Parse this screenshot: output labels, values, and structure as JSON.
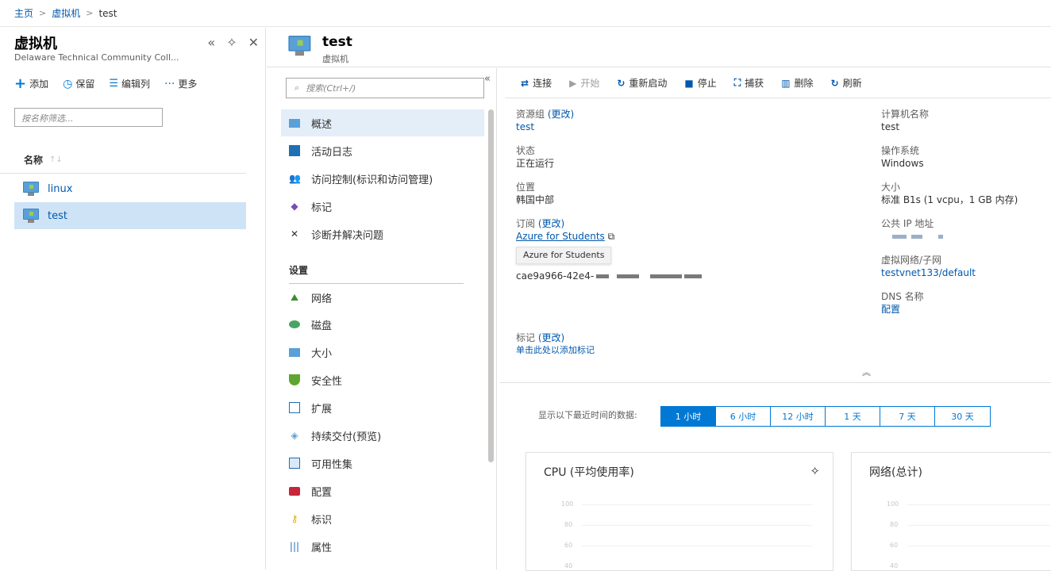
{
  "breadcrumb": [
    "主页",
    "虚拟机",
    "test"
  ],
  "left_blade": {
    "title": "虚拟机",
    "subtitle": "Delaware Technical Community Coll...",
    "toolbar": [
      {
        "icon": "plus-icon",
        "label": "添加"
      },
      {
        "icon": "clock-icon",
        "label": "保留"
      },
      {
        "icon": "columns-icon",
        "label": "编辑列"
      },
      {
        "icon": "more-icon",
        "label": "更多"
      }
    ],
    "filter_placeholder": "按名称筛选...",
    "column_header": "名称",
    "vms": [
      {
        "name": "linux",
        "selected": false
      },
      {
        "name": "test",
        "selected": true
      }
    ]
  },
  "vm_header": {
    "title": "test",
    "subtitle": "虚拟机"
  },
  "menu": {
    "search_placeholder": "搜索(Ctrl+/)",
    "items_top": [
      {
        "label": "概述",
        "icon": "monitor-icon",
        "active": true
      },
      {
        "label": "活动日志",
        "icon": "log-icon"
      },
      {
        "label": "访问控制(标识和访问管理)",
        "icon": "people-icon"
      },
      {
        "label": "标记",
        "icon": "tag-icon"
      },
      {
        "label": "诊断并解决问题",
        "icon": "wrench-icon"
      }
    ],
    "section": "设置",
    "items_settings": [
      {
        "label": "网络",
        "icon": "network-icon"
      },
      {
        "label": "磁盘",
        "icon": "disk-icon"
      },
      {
        "label": "大小",
        "icon": "monitor-icon"
      },
      {
        "label": "安全性",
        "icon": "shield-icon"
      },
      {
        "label": "扩展",
        "icon": "extensions-icon"
      },
      {
        "label": "持续交付(预览)",
        "icon": "delivery-icon"
      },
      {
        "label": "可用性集",
        "icon": "availability-icon"
      },
      {
        "label": "配置",
        "icon": "config-icon"
      },
      {
        "label": "标识",
        "icon": "identity-icon"
      },
      {
        "label": "属性",
        "icon": "properties-icon"
      }
    ]
  },
  "commands": [
    {
      "label": "连接",
      "icon": "connect-icon",
      "disabled": false
    },
    {
      "label": "开始",
      "icon": "play-icon",
      "disabled": true
    },
    {
      "label": "重新启动",
      "icon": "restart-icon",
      "disabled": false
    },
    {
      "label": "停止",
      "icon": "stop-icon",
      "disabled": false
    },
    {
      "label": "捕获",
      "icon": "capture-icon",
      "disabled": false
    },
    {
      "label": "删除",
      "icon": "delete-icon",
      "disabled": false
    },
    {
      "label": "刷新",
      "icon": "refresh-icon",
      "disabled": false
    }
  ],
  "essentials": {
    "resource_group_label": "资源组",
    "change": "(更改)",
    "resource_group_value": "test",
    "status_label": "状态",
    "status_value": "正在运行",
    "location_label": "位置",
    "location_value": "韩国中部",
    "subscription_label": "订阅",
    "subscription_value": "Azure for Students",
    "tooltip": "Azure for Students",
    "subscription_id_value": "cae9a966-42e4-",
    "computer_name_label": "计算机名称",
    "computer_name_value": "test",
    "os_label": "操作系统",
    "os_value": "Windows",
    "size_label": "大小",
    "size_value": "标准 B1s (1 vcpu，1 GB 内存)",
    "public_ip_label": "公共 IP 地址",
    "vnet_label": "虚拟网络/子网",
    "vnet_value": "testvnet133/default",
    "dns_label": "DNS 名称",
    "dns_value": "配置",
    "tags_label": "标记",
    "tags_change": "(更改)",
    "tags_add": "单击此处以添加标记"
  },
  "time_range": {
    "label": "显示以下最近时间的数据:",
    "options": [
      "1 小时",
      "6 小时",
      "12 小时",
      "1 天",
      "7 天",
      "30 天"
    ],
    "selected": 0
  },
  "charts": [
    {
      "title": "CPU (平均使用率)"
    },
    {
      "title": "网络(总计)"
    }
  ],
  "chart_ticks": [
    "100",
    "80",
    "60",
    "40"
  ],
  "colors": {
    "accent": "#0078d4",
    "link": "#0058ad",
    "selected_row": "#cfe3f7"
  }
}
